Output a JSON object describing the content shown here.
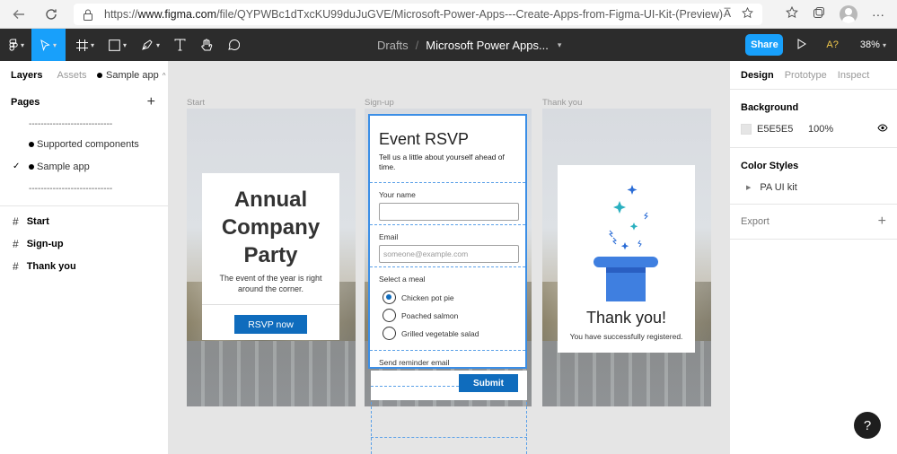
{
  "browser": {
    "url_prefix": "https://",
    "url_host": "www.figma.com",
    "url_path": "/file/QYPWBc1dTxcKU99duJuGVE/Microsoft-Power-Apps---Create-Apps-from-Figma-UI-Kit-(Preview)-(Community...",
    "read_aloud": "A̅"
  },
  "toolbar": {
    "breadcrumb_root": "Drafts",
    "file_name": "Microsoft Power Apps...",
    "share_label": "Share",
    "a11y_label": "A?",
    "zoom_label": "38%"
  },
  "left_panel": {
    "tabs": [
      "Layers",
      "Assets"
    ],
    "current_page": "Sample app",
    "pages_heading": "Pages",
    "pages": [
      {
        "label": "----------------------------",
        "type": "divider"
      },
      {
        "label": "Supported components",
        "type": "page"
      },
      {
        "label": "Sample app",
        "type": "page",
        "selected": true
      },
      {
        "label": "----------------------------",
        "type": "divider"
      }
    ],
    "layers": [
      "Start",
      "Sign-up",
      "Thank you"
    ]
  },
  "right_panel": {
    "tabs": [
      "Design",
      "Prototype",
      "Inspect"
    ],
    "background_heading": "Background",
    "background_hex": "E5E5E5",
    "background_opacity": "100%",
    "color_styles_heading": "Color Styles",
    "color_style_item": "PA UI kit",
    "export_heading": "Export"
  },
  "canvas": {
    "frames": [
      "Start",
      "Sign-up",
      "Thank you"
    ],
    "start": {
      "title_line1": "Annual",
      "title_line2": "Company",
      "title_line3": "Party",
      "subtitle_line1": "The event of the year is right",
      "subtitle_line2": "around the corner.",
      "button": "RSVP now"
    },
    "signup": {
      "title": "Event RSVP",
      "description": "Tell us a little about yourself ahead of time.",
      "name_label": "Your name",
      "email_label": "Email",
      "email_placeholder": "someone@example.com",
      "meal_label": "Select a meal",
      "meals": [
        "Chicken pot pie",
        "Poached salmon",
        "Grilled vegetable salad"
      ],
      "reminder_label": "Send reminder email",
      "submit": "Submit"
    },
    "thankyou": {
      "title": "Thank you!",
      "subtitle": "You have successfully registered."
    }
  },
  "help_label": "?",
  "colors": {
    "accent": "#18a0fb",
    "button_blue": "#0f6cbd",
    "toolbar_bg": "#2c2c2c",
    "canvas_bg": "#e5e5e5"
  }
}
